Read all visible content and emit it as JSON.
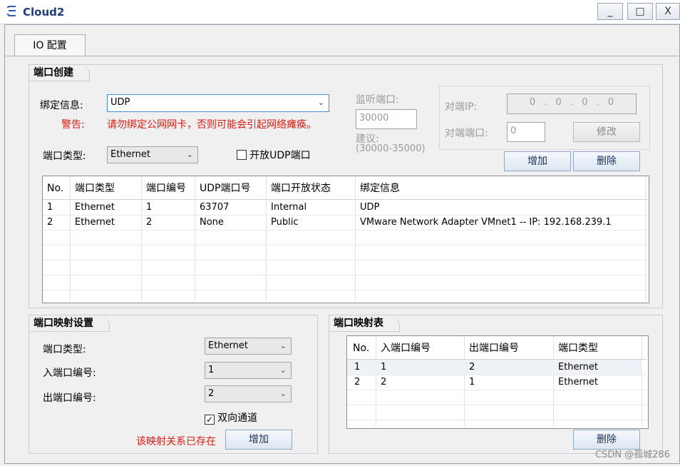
{
  "window": {
    "title": "Cloud2",
    "minimize": "_",
    "maximize": "□",
    "close": "X"
  },
  "tabs": [
    {
      "label": "IO 配置"
    }
  ],
  "port_create": {
    "title": "端口创建",
    "bind_label": "绑定信息:",
    "bind_value": "UDP",
    "warning_label": "警告:",
    "warning_text": "请勿绑定公网网卡，否则可能会引起网络瘫痪。",
    "port_type_label": "端口类型:",
    "port_type_value": "Ethernet",
    "open_udp_label": "开放UDP端口",
    "listen_port_label": "监听端口:",
    "listen_port_value": "30000",
    "suggest_label": "建议:",
    "suggest_range": "(30000-35000)",
    "peer_ip_label": "对端IP:",
    "peer_ip_value": "0 . 0 . 0 . 0",
    "peer_port_label": "对端端口:",
    "peer_port_value": "0",
    "modify_button": "修改",
    "add_button": "增加",
    "delete_button": "删除",
    "table": {
      "headers": [
        "No.",
        "端口类型",
        "端口编号",
        "UDP端口号",
        "端口开放状态",
        "绑定信息"
      ],
      "rows": [
        [
          "1",
          "Ethernet",
          "1",
          "63707",
          "Internal",
          "UDP"
        ],
        [
          "2",
          "Ethernet",
          "2",
          "None",
          "Public",
          "VMware Network Adapter VMnet1 -- IP: 192.168.239.1"
        ]
      ]
    }
  },
  "port_mapping": {
    "title": "端口映射设置",
    "type_label": "端口类型:",
    "type_value": "Ethernet",
    "in_label": "入端口编号:",
    "in_value": "1",
    "out_label": "出端口编号:",
    "out_value": "2",
    "bidirectional_label": "双向通道",
    "bidirectional_checked": true,
    "exists_msg": "该映射关系已存在",
    "add_button": "增加"
  },
  "mapping_table": {
    "title": "端口映射表",
    "headers": [
      "No.",
      "入端口编号",
      "出端口编号",
      "端口类型"
    ],
    "rows": [
      [
        "1",
        "1",
        "2",
        "Ethernet"
      ],
      [
        "2",
        "2",
        "1",
        "Ethernet"
      ]
    ],
    "delete_button": "删除"
  },
  "watermark": "CSDN @孤城286",
  "colors": {
    "accent": "#1f3d7a",
    "warning": "#e0190e",
    "selection": "#cce4f7"
  },
  "icons": {
    "app": "cloud-icon",
    "dropdown": "chevron-down-icon",
    "checkbox": "checkbox-icon"
  }
}
